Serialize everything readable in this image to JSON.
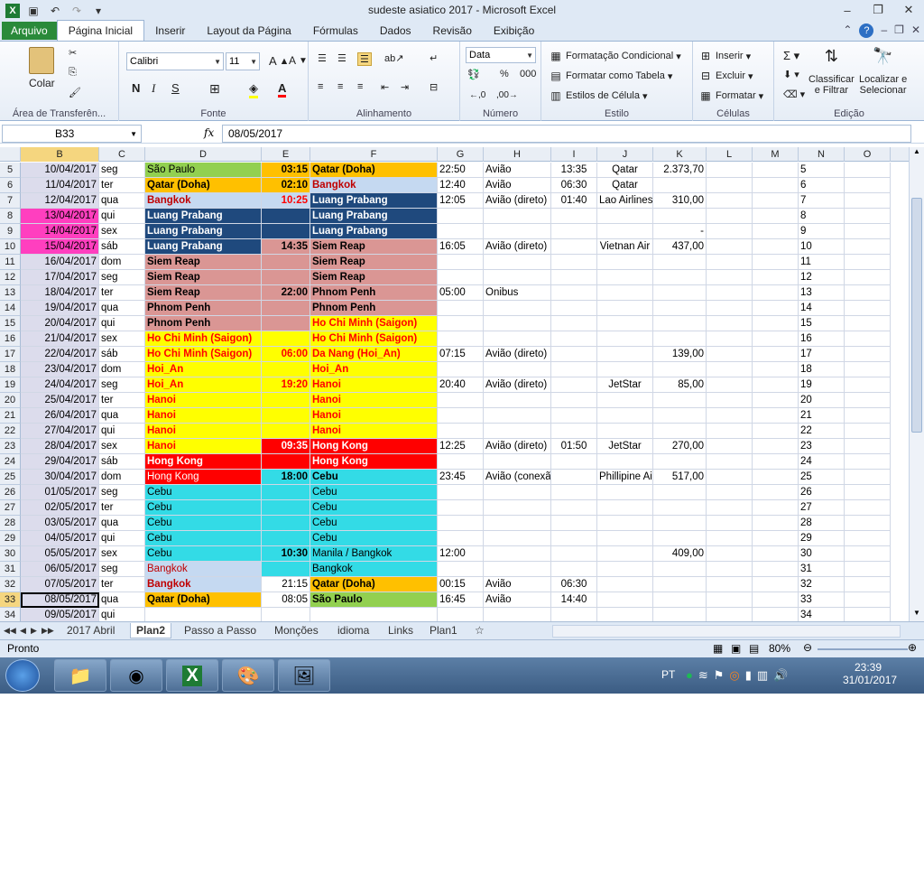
{
  "window": {
    "title": "sudeste asiatico 2017  -  Microsoft Excel"
  },
  "tabs": [
    "Arquivo",
    "Página Inicial",
    "Inserir",
    "Layout da Página",
    "Fórmulas",
    "Dados",
    "Revisão",
    "Exibição"
  ],
  "ribbon": {
    "clipboard": {
      "paste_label": "Colar",
      "group_label": "Área de Transferên..."
    },
    "font": {
      "name": "Calibri",
      "size": "11",
      "group_label": "Fonte"
    },
    "alignment": {
      "group_label": "Alinhamento"
    },
    "number": {
      "format": "Data",
      "group_label": "Número"
    },
    "styles": {
      "cond_format": "Formatação Condicional",
      "format_table": "Formatar como Tabela",
      "cell_styles": "Estilos de Célula",
      "group_label": "Estilo"
    },
    "cells": {
      "insert": "Inserir",
      "delete": "Excluir",
      "format": "Formatar",
      "group_label": "Células"
    },
    "editing": {
      "sort_l1": "Classificar",
      "sort_l2": "e Filtrar",
      "find_l1": "Localizar e",
      "find_l2": "Selecionar",
      "group_label": "Edição"
    }
  },
  "formula_bar": {
    "name_box": "B33",
    "fx": "fx",
    "content": "08/05/2017"
  },
  "columns": [
    "B",
    "C",
    "D",
    "E",
    "F",
    "G",
    "H",
    "I",
    "J",
    "K",
    "L",
    "M",
    "N",
    "O"
  ],
  "rows": [
    {
      "n": "5",
      "b": "10/04/2017",
      "c": "seg",
      "d": "São Paulo",
      "e": "03:15",
      "f": "Qatar (Doha)",
      "g": "22:50",
      "h": "Avião",
      "i": "13:35",
      "j": "Qatar",
      "k": "2.373,70"
    },
    {
      "n": "6",
      "b": "11/04/2017",
      "c": "ter",
      "d": "Qatar (Doha)",
      "e": "02:10",
      "f": "Bangkok",
      "g": "12:40",
      "h": "Avião",
      "i": "06:30",
      "j": "Qatar",
      "k": ""
    },
    {
      "n": "7",
      "b": "12/04/2017",
      "c": "qua",
      "d": "Bangkok",
      "e": "10:25",
      "f": "Luang Prabang",
      "g": "12:05",
      "h": "Avião (direto)",
      "i": "01:40",
      "j": "Lao Airlines",
      "k": "310,00"
    },
    {
      "n": "8",
      "b": "13/04/2017",
      "c": "qui",
      "d": "Luang Prabang",
      "e": "",
      "f": "Luang Prabang",
      "g": "",
      "h": "",
      "i": "",
      "j": "",
      "k": ""
    },
    {
      "n": "9",
      "b": "14/04/2017",
      "c": "sex",
      "d": "Luang Prabang",
      "e": "",
      "f": "Luang Prabang",
      "g": "",
      "h": "",
      "i": "",
      "j": "",
      "k": "-"
    },
    {
      "n": "10",
      "b": "15/04/2017",
      "c": "sáb",
      "d": "Luang Prabang",
      "e": "14:35",
      "f": "Siem Reap",
      "g": "16:05",
      "h": "Avião (direto)",
      "i": "",
      "j": "Vietnan Air",
      "k": "437,00"
    },
    {
      "n": "11",
      "b": "16/04/2017",
      "c": "dom",
      "d": "Siem Reap",
      "e": "",
      "f": "Siem Reap",
      "g": "",
      "h": "",
      "i": "",
      "j": "",
      "k": ""
    },
    {
      "n": "12",
      "b": "17/04/2017",
      "c": "seg",
      "d": "Siem Reap",
      "e": "",
      "f": "Siem Reap",
      "g": "",
      "h": "",
      "i": "",
      "j": "",
      "k": ""
    },
    {
      "n": "13",
      "b": "18/04/2017",
      "c": "ter",
      "d": "Siem Reap",
      "e": "22:00",
      "f": "Phnom Penh",
      "g": "05:00",
      "h": "Onibus",
      "i": "",
      "j": "",
      "k": ""
    },
    {
      "n": "14",
      "b": "19/04/2017",
      "c": "qua",
      "d": "Phnom Penh",
      "e": "",
      "f": "Phnom Penh",
      "g": "",
      "h": "",
      "i": "",
      "j": "",
      "k": ""
    },
    {
      "n": "15",
      "b": "20/04/2017",
      "c": "qui",
      "d": "Phnom Penh",
      "e": "",
      "f": "Ho Chi Minh (Saigon)",
      "g": "",
      "h": "",
      "i": "",
      "j": "",
      "k": ""
    },
    {
      "n": "16",
      "b": "21/04/2017",
      "c": "sex",
      "d": "Ho Chi Minh (Saigon)",
      "e": "",
      "f": "Ho Chi Minh (Saigon)",
      "g": "",
      "h": "",
      "i": "",
      "j": "",
      "k": ""
    },
    {
      "n": "17",
      "b": "22/04/2017",
      "c": "sáb",
      "d": "Ho Chi Minh (Saigon)",
      "e": "06:00",
      "f": "Da Nang (Hoi_An)",
      "g": "07:15",
      "h": "Avião (direto)",
      "i": "",
      "j": "",
      "k": "139,00"
    },
    {
      "n": "18",
      "b": "23/04/2017",
      "c": "dom",
      "d": "Hoi_An",
      "e": "",
      "f": "Hoi_An",
      "g": "",
      "h": "",
      "i": "",
      "j": "",
      "k": ""
    },
    {
      "n": "19",
      "b": "24/04/2017",
      "c": "seg",
      "d": "Hoi_An",
      "e": "19:20",
      "f": "Hanoi",
      "g": "20:40",
      "h": "Avião (direto)",
      "i": "",
      "j": "JetStar",
      "k": "85,00"
    },
    {
      "n": "20",
      "b": "25/04/2017",
      "c": "ter",
      "d": "Hanoi",
      "e": "",
      "f": "Hanoi",
      "g": "",
      "h": "",
      "i": "",
      "j": "",
      "k": ""
    },
    {
      "n": "21",
      "b": "26/04/2017",
      "c": "qua",
      "d": "Hanoi",
      "e": "",
      "f": "Hanoi",
      "g": "",
      "h": "",
      "i": "",
      "j": "",
      "k": ""
    },
    {
      "n": "22",
      "b": "27/04/2017",
      "c": "qui",
      "d": "Hanoi",
      "e": "",
      "f": "Hanoi",
      "g": "",
      "h": "",
      "i": "",
      "j": "",
      "k": ""
    },
    {
      "n": "23",
      "b": "28/04/2017",
      "c": "sex",
      "d": "Hanoi",
      "e": "09:35",
      "f": "Hong Kong",
      "g": "12:25",
      "h": "Avião (direto)",
      "i": "01:50",
      "j": "JetStar",
      "k": "270,00"
    },
    {
      "n": "24",
      "b": "29/04/2017",
      "c": "sáb",
      "d": "Hong Kong",
      "e": "",
      "f": "Hong Kong",
      "g": "",
      "h": "",
      "i": "",
      "j": "",
      "k": ""
    },
    {
      "n": "25",
      "b": "30/04/2017",
      "c": "dom",
      "d": "Hong Kong",
      "e": "18:00",
      "f": "Cebu",
      "g": "23:45",
      "h": "Avião (conexão)",
      "i": "",
      "j": "Phillipine Air",
      "k": "517,00"
    },
    {
      "n": "26",
      "b": "01/05/2017",
      "c": "seg",
      "d": "Cebu",
      "e": "",
      "f": "Cebu",
      "g": "",
      "h": "",
      "i": "",
      "j": "",
      "k": ""
    },
    {
      "n": "27",
      "b": "02/05/2017",
      "c": "ter",
      "d": "Cebu",
      "e": "",
      "f": "Cebu",
      "g": "",
      "h": "",
      "i": "",
      "j": "",
      "k": ""
    },
    {
      "n": "28",
      "b": "03/05/2017",
      "c": "qua",
      "d": "Cebu",
      "e": "",
      "f": "Cebu",
      "g": "",
      "h": "",
      "i": "",
      "j": "",
      "k": ""
    },
    {
      "n": "29",
      "b": "04/05/2017",
      "c": "qui",
      "d": "Cebu",
      "e": "",
      "f": "Cebu",
      "g": "",
      "h": "",
      "i": "",
      "j": "",
      "k": ""
    },
    {
      "n": "30",
      "b": "05/05/2017",
      "c": "sex",
      "d": "Cebu",
      "e": "10:30",
      "f": "Manila / Bangkok",
      "g": "12:00",
      "h": "",
      "i": "",
      "j": "",
      "k": "409,00"
    },
    {
      "n": "31",
      "b": "06/05/2017",
      "c": "seg",
      "d": "Bangkok",
      "e": "",
      "f": "Bangkok",
      "g": "",
      "h": "",
      "i": "",
      "j": "",
      "k": ""
    },
    {
      "n": "32",
      "b": "07/05/2017",
      "c": "ter",
      "d": "Bangkok",
      "e": "21:15",
      "f": "Qatar (Doha)",
      "g": "00:15",
      "h": "Avião",
      "i": "06:30",
      "j": "",
      "k": ""
    },
    {
      "n": "33",
      "b": "08/05/2017",
      "c": "qua",
      "d": "Qatar (Doha)",
      "e": "08:05",
      "f": "São Paulo",
      "g": "16:45",
      "h": "Avião",
      "i": "14:40",
      "j": "",
      "k": ""
    },
    {
      "n": "34",
      "b": "09/05/2017",
      "c": "qui",
      "d": "",
      "e": "",
      "f": "",
      "g": "",
      "h": "",
      "i": "",
      "j": "",
      "k": ""
    }
  ],
  "colors": {
    "green": "#92d050",
    "orange": "#ffc000",
    "lightblue": "#c5d9f1",
    "navy": "#1f497d",
    "pink": "#da9694",
    "yellow": "#ffff00",
    "red": "#ff0000",
    "cyan": "#33dbe6",
    "magenta": "#ff3fbf",
    "datebg": "#dcdcec",
    "selection": "#f5d67f",
    "accent": "#2a8a3a"
  },
  "sheets": [
    "2017 Abril",
    "Plan2",
    "Passo a Passo",
    "Monções",
    "idioma",
    "Links",
    "Plan1"
  ],
  "active_sheet": "Plan2",
  "status": {
    "ready": "Pronto",
    "zoom": "80%"
  },
  "taskbar": {
    "lang": "PT",
    "time": "23:39",
    "date": "31/01/2017"
  }
}
